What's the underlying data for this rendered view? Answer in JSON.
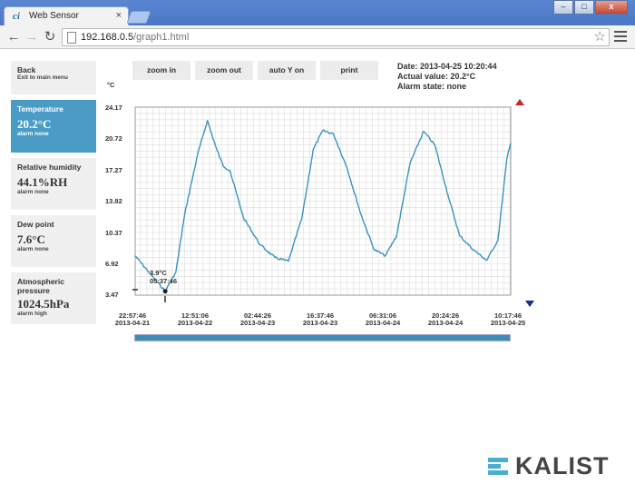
{
  "browser": {
    "tab_title": "Web Sensor",
    "tab_favicon": "ci",
    "url_host": "192.168.0.5",
    "url_path": "/graph1.html",
    "window_controls": [
      "–",
      "□",
      "x"
    ]
  },
  "sidebar": {
    "back": {
      "title": "Back",
      "subtitle": "Exit to main menu"
    },
    "items": [
      {
        "title": "Temperature",
        "value": "20.2°C",
        "alarm": "alarm none",
        "active": true
      },
      {
        "title": "Relative humidity",
        "value": "44.1%RH",
        "alarm": "alarm none",
        "active": false
      },
      {
        "title": "Dew point",
        "value": "7.6°C",
        "alarm": "alarm none",
        "active": false
      },
      {
        "title": "Atmospheric pressure",
        "value": "1024.5hPa",
        "alarm": "alarm high",
        "active": false
      }
    ]
  },
  "controls": {
    "zoom_in": "zoom in",
    "zoom_out": "zoom out",
    "auto_y": "auto Y on",
    "print": "print"
  },
  "info": {
    "date": "Date: 2013-04-25 10:20:44",
    "actual": "Actual value: 20.2°C",
    "alarm": "Alarm state: none"
  },
  "logo": {
    "text": "KALIST"
  },
  "colors": {
    "accent": "#4a9cc7",
    "line": "#3a93bd",
    "alarm_up": "#d12020",
    "alarm_down": "#1a2e8a"
  },
  "chart_data": {
    "type": "line",
    "ylabel": "°C",
    "y_ticks": [
      24.17,
      20.72,
      17.27,
      13.82,
      10.37,
      6.92,
      3.47
    ],
    "ylim": [
      3.47,
      24.17
    ],
    "x_ticks": [
      {
        "time": "22:57:46",
        "date": "2013-04-21"
      },
      {
        "time": "12:51:06",
        "date": "2013-04-22"
      },
      {
        "time": "02:44:26",
        "date": "2013-04-23"
      },
      {
        "time": "16:37:46",
        "date": "2013-04-23"
      },
      {
        "time": "06:31:06",
        "date": "2013-04-24"
      },
      {
        "time": "20:24:26",
        "date": "2013-04-24"
      },
      {
        "time": "10:17:46",
        "date": "2013-04-25"
      }
    ],
    "xlim": [
      "2013-04-21 22:57:46",
      "2013-04-25 10:20:44"
    ],
    "grid": true,
    "min_marker": {
      "label": "3.9°C",
      "time": "05:37:46",
      "x": "2013-04-22 05:37:46",
      "y": 3.9
    },
    "series": [
      {
        "x": [
          "2013-04-21 22:57:46",
          "2013-04-22 02:00:00",
          "2013-04-22 05:37:46",
          "2013-04-22 08:00:00",
          "2013-04-22 10:00:00",
          "2013-04-22 12:51:06",
          "2013-04-22 15:00:00",
          "2013-04-22 17:00:00",
          "2013-04-22 18:30:00",
          "2013-04-22 20:00:00",
          "2013-04-22 23:00:00",
          "2013-04-23 02:44:26",
          "2013-04-23 06:00:00",
          "2013-04-23 09:00:00",
          "2013-04-23 12:00:00",
          "2013-04-23 14:30:00",
          "2013-04-23 16:37:46",
          "2013-04-23 19:00:00",
          "2013-04-23 22:00:00",
          "2013-04-24 01:00:00",
          "2013-04-24 04:00:00",
          "2013-04-24 06:31:06",
          "2013-04-24 09:00:00",
          "2013-04-24 12:00:00",
          "2013-04-24 15:00:00",
          "2013-04-24 17:30:00",
          "2013-04-24 20:24:26",
          "2013-04-24 23:00:00",
          "2013-04-25 02:00:00",
          "2013-04-25 05:00:00",
          "2013-04-25 07:30:00",
          "2013-04-25 09:30:00",
          "2013-04-25 10:20:44"
        ],
        "y": [
          7.8,
          6.0,
          3.9,
          6.0,
          12.5,
          19.0,
          22.7,
          19.6,
          17.7,
          17.2,
          12.0,
          9.0,
          7.6,
          7.2,
          12.0,
          19.5,
          21.6,
          21.2,
          17.5,
          12.5,
          8.5,
          7.8,
          10.0,
          18.0,
          21.5,
          20.0,
          14.5,
          10.0,
          8.5,
          7.3,
          9.5,
          18.5,
          20.2
        ]
      }
    ]
  }
}
